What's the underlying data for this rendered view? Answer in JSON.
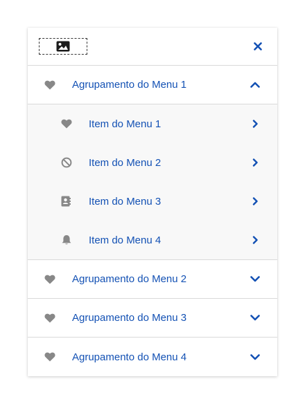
{
  "colors": {
    "link": "#1351b4",
    "icon_gray": "#888888",
    "divider": "#d9d9d9",
    "submenu_bg": "#f8f8f8"
  },
  "header": {
    "logo_icon": "image-icon",
    "close_icon": "close-icon"
  },
  "groups": [
    {
      "label": "Agrupamento do Menu 1",
      "icon": "heart-icon",
      "expanded": true,
      "items": [
        {
          "label": "Item do Menu 1",
          "icon": "heart-icon"
        },
        {
          "label": "Item do Menu 2",
          "icon": "ban-icon"
        },
        {
          "label": "Item do Menu 3",
          "icon": "address-book-icon"
        },
        {
          "label": "Item do Menu 4",
          "icon": "bell-icon"
        }
      ]
    },
    {
      "label": "Agrupamento do Menu 2",
      "icon": "heart-icon",
      "expanded": false
    },
    {
      "label": "Agrupamento do Menu 3",
      "icon": "heart-icon",
      "expanded": false
    },
    {
      "label": "Agrupamento do Menu 4",
      "icon": "heart-icon",
      "expanded": false
    }
  ]
}
